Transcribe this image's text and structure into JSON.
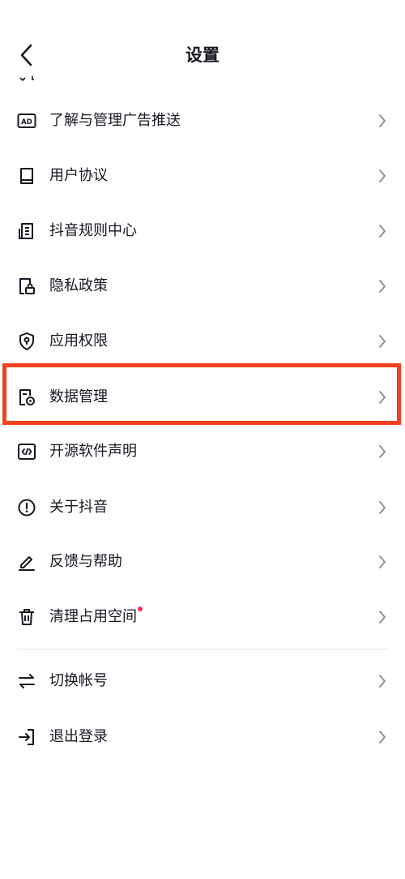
{
  "header": {
    "title": "设置"
  },
  "menu": [
    {
      "label": "了解与管理广告推送",
      "icon": "ad-icon"
    },
    {
      "label": "用户协议",
      "icon": "book-icon"
    },
    {
      "label": "抖音规则中心",
      "icon": "document-list-icon"
    },
    {
      "label": "隐私政策",
      "icon": "file-lock-icon"
    },
    {
      "label": "应用权限",
      "icon": "shield-icon"
    },
    {
      "label": "数据管理",
      "icon": "file-gear-icon"
    },
    {
      "label": "开源软件声明",
      "icon": "code-icon"
    },
    {
      "label": "关于抖音",
      "icon": "exclamation-circle-icon"
    },
    {
      "label": "反馈与帮助",
      "icon": "pen-icon"
    },
    {
      "label": "清理占用空间",
      "icon": "trash-icon",
      "badge_color": "#fe2c55"
    }
  ],
  "account": [
    {
      "label": "切换帐号",
      "icon": "switch-arrows-icon"
    },
    {
      "label": "退出登录",
      "icon": "logout-icon"
    }
  ],
  "colors": {
    "highlight": "#f1411f",
    "badge": "#fe2c55",
    "text": "#161823"
  }
}
